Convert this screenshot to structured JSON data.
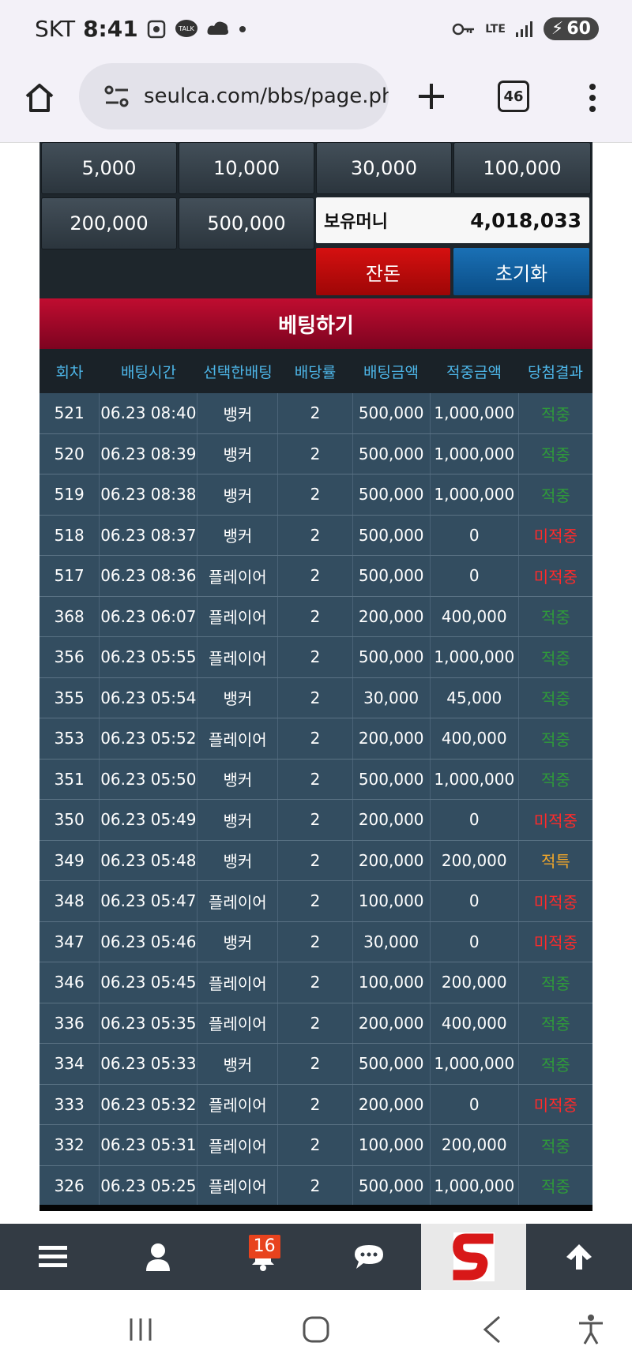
{
  "status_bar": {
    "carrier": "SKT",
    "time": "8:41",
    "network": "LTE",
    "battery": "60"
  },
  "browser": {
    "url": "seulca.com/bbs/page.php",
    "tab_count": "46"
  },
  "game": {
    "chips": [
      "5,000",
      "10,000",
      "30,000",
      "100,000",
      "200,000",
      "500,000"
    ],
    "balance_label": "보유머니",
    "balance_value": "4,018,033",
    "change_label": "잔돈",
    "reset_label": "초기화",
    "bet_header": "베팅하기"
  },
  "table": {
    "headers": [
      "회차",
      "배팅시간",
      "선택한배팅",
      "배당률",
      "배팅금액",
      "적중금액",
      "당첨결과"
    ],
    "rows": [
      [
        "521",
        "06.23 08:40",
        "뱅커",
        "2",
        "500,000",
        "1,000,000",
        "적중"
      ],
      [
        "520",
        "06.23 08:39",
        "뱅커",
        "2",
        "500,000",
        "1,000,000",
        "적중"
      ],
      [
        "519",
        "06.23 08:38",
        "뱅커",
        "2",
        "500,000",
        "1,000,000",
        "적중"
      ],
      [
        "518",
        "06.23 08:37",
        "뱅커",
        "2",
        "500,000",
        "0",
        "미적중"
      ],
      [
        "517",
        "06.23 08:36",
        "플레이어",
        "2",
        "500,000",
        "0",
        "미적중"
      ],
      [
        "368",
        "06.23 06:07",
        "플레이어",
        "2",
        "200,000",
        "400,000",
        "적중"
      ],
      [
        "356",
        "06.23 05:55",
        "플레이어",
        "2",
        "500,000",
        "1,000,000",
        "적중"
      ],
      [
        "355",
        "06.23 05:54",
        "뱅커",
        "2",
        "30,000",
        "45,000",
        "적중"
      ],
      [
        "353",
        "06.23 05:52",
        "플레이어",
        "2",
        "200,000",
        "400,000",
        "적중"
      ],
      [
        "351",
        "06.23 05:50",
        "뱅커",
        "2",
        "500,000",
        "1,000,000",
        "적중"
      ],
      [
        "350",
        "06.23 05:49",
        "뱅커",
        "2",
        "200,000",
        "0",
        "미적중"
      ],
      [
        "349",
        "06.23 05:48",
        "뱅커",
        "2",
        "200,000",
        "200,000",
        "적특"
      ],
      [
        "348",
        "06.23 05:47",
        "플레이어",
        "2",
        "100,000",
        "0",
        "미적중"
      ],
      [
        "347",
        "06.23 05:46",
        "뱅커",
        "2",
        "30,000",
        "0",
        "미적중"
      ],
      [
        "346",
        "06.23 05:45",
        "플레이어",
        "2",
        "100,000",
        "200,000",
        "적중"
      ],
      [
        "336",
        "06.23 05:35",
        "플레이어",
        "2",
        "200,000",
        "400,000",
        "적중"
      ],
      [
        "334",
        "06.23 05:33",
        "뱅커",
        "2",
        "500,000",
        "1,000,000",
        "적중"
      ],
      [
        "333",
        "06.23 05:32",
        "플레이어",
        "2",
        "200,000",
        "0",
        "미적중"
      ],
      [
        "332",
        "06.23 05:31",
        "플레이어",
        "2",
        "100,000",
        "200,000",
        "적중"
      ],
      [
        "326",
        "06.23 05:25",
        "플레이어",
        "2",
        "500,000",
        "1,000,000",
        "적중"
      ]
    ]
  },
  "bottom_nav": {
    "notification_count": "16",
    "items": [
      "menu-icon",
      "user-icon",
      "bell-icon",
      "chat-icon",
      "site-logo",
      "arrow-up-icon"
    ]
  },
  "colors": {
    "header_red": "#b00a2c",
    "row_bg": "#334d60",
    "win": "#2f9a3a",
    "lose": "#ff2a2a",
    "tie": "#f2a72a",
    "head_text": "#4db6e8"
  }
}
